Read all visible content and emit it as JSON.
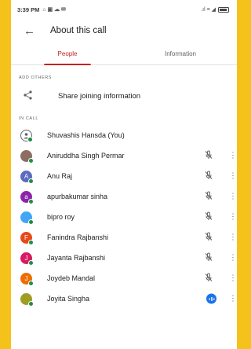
{
  "status_bar": {
    "time": "3:39 PM",
    "left_glyphs": "⌂ ▣ ☁ ✉",
    "right_glyphs": ".ıl ≡ ◢"
  },
  "header": {
    "title": "About this call"
  },
  "tabs": [
    {
      "label": "People"
    },
    {
      "label": "Information"
    }
  ],
  "sections": {
    "add_others": "ADD OTHERS",
    "in_call": "IN CALL"
  },
  "share": {
    "label": "Share joining information"
  },
  "participants": [
    {
      "name": "Shuvashis Hansda (You)",
      "avatar_color": "#ffffff",
      "initial": "",
      "mic": "none"
    },
    {
      "name": "Aniruddha Singh Permar",
      "avatar_color": "#8d6e63",
      "initial": "",
      "mic": "muted"
    },
    {
      "name": "Anu Raj",
      "avatar_color": "#5c6bc0",
      "initial": "A",
      "mic": "muted"
    },
    {
      "name": "apurbakumar sinha",
      "avatar_color": "#8e24aa",
      "initial": "a",
      "mic": "muted"
    },
    {
      "name": "bipro roy",
      "avatar_color": "#42a5f5",
      "initial": "",
      "mic": "muted"
    },
    {
      "name": "Fanindra Rajbanshi",
      "avatar_color": "#e64a19",
      "initial": "F",
      "mic": "muted"
    },
    {
      "name": "Jayanta Rajbanshi",
      "avatar_color": "#d81b60",
      "initial": "J",
      "mic": "muted"
    },
    {
      "name": "Joydeb Mandal",
      "avatar_color": "#ef6c00",
      "initial": "J",
      "mic": "muted"
    },
    {
      "name": "Joyita Singha",
      "avatar_color": "#9e9d24",
      "initial": "",
      "mic": "speaking"
    }
  ]
}
